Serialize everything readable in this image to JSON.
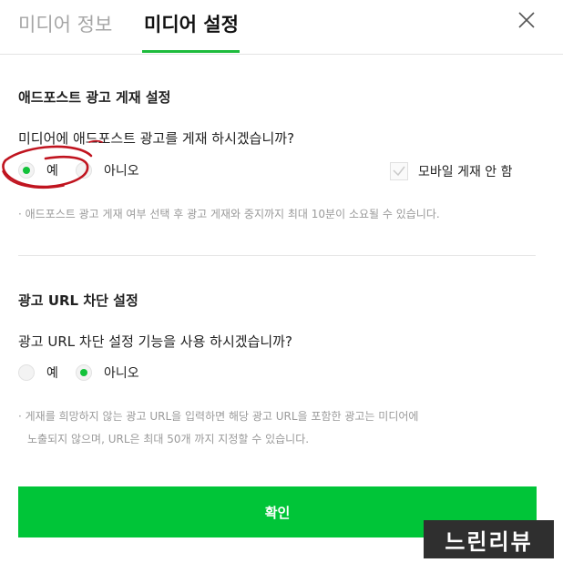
{
  "tabs": [
    {
      "label": "미디어 정보",
      "active": false
    },
    {
      "label": "미디어 설정",
      "active": true
    }
  ],
  "colors": {
    "accent": "#00c538",
    "radio_dot": "#13c23a",
    "tab_underline": "#1dbb3c"
  },
  "adpost_section": {
    "title": "애드포스트 광고 게재 설정",
    "question": "미디어에 애드포스트 광고를 게재 하시겠습니까?",
    "options": [
      {
        "label": "예",
        "selected": true
      },
      {
        "label": "아니오",
        "selected": false
      }
    ],
    "mobile_checkbox": {
      "label": "모바일 게재 안 함",
      "checked": false
    },
    "note": "· 애드포스트 광고 게재 여부 선택 후 광고 게재와 중지까지 최대 10분이 소요될 수 있습니다."
  },
  "url_section": {
    "title": "광고 URL 차단 설정",
    "question": "광고 URL 차단 설정 기능을 사용 하시겠습니까?",
    "options": [
      {
        "label": "예",
        "selected": false
      },
      {
        "label": "아니오",
        "selected": true
      }
    ],
    "note_line1": "· 게재를 희망하지 않는 광고 URL을 입력하면 해당 광고 URL을 포함한 광고는 미디어에",
    "note_line2": "노출되지 않으며, URL은 최대 50개 까지 지정할 수 있습니다."
  },
  "confirm_label": "확인",
  "watermark": "느린리뷰",
  "icons": {
    "close": "close-icon",
    "check": "check-icon"
  }
}
